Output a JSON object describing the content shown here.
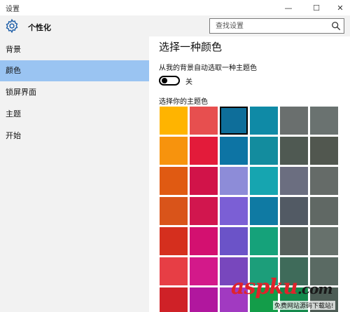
{
  "window": {
    "title": "设置",
    "controls": {
      "minimize": "—",
      "maximize": "☐",
      "close": "✕"
    }
  },
  "sidebar": {
    "header_title": "个性化",
    "header_icon": "gear-icon",
    "items": [
      {
        "label": "背景",
        "active": false
      },
      {
        "label": "颜色",
        "active": true
      },
      {
        "label": "锁屏界面",
        "active": false
      },
      {
        "label": "主题",
        "active": false
      },
      {
        "label": "开始",
        "active": false
      }
    ],
    "active_color": "#9ac4f2"
  },
  "search": {
    "placeholder": "查找设置",
    "icon": "search-icon"
  },
  "main": {
    "heading": "选择一种颜色",
    "auto_pick_label": "从我的背景自动选取一种主题色",
    "toggle_state_label": "关",
    "toggle_on": false,
    "accent_label": "选择你的主题色"
  },
  "swatches": [
    [
      "#ffb400",
      "#e74f4f",
      "#0e6e9a",
      "#0f8aa6",
      "#6a6f6e",
      "#6a7270"
    ],
    [
      "#f7930d",
      "#e31b3a",
      "#0d74a4",
      "#138c9e",
      "#4f5952",
      "#51574f"
    ],
    [
      "#e05a12",
      "#d11349",
      "#8d8cd8",
      "#16a5b0",
      "#6b6e80",
      "#656b68"
    ],
    [
      "#d9541a",
      "#d1164e",
      "#7b5fd5",
      "#0f7aa3",
      "#525a64",
      "#606864"
    ],
    [
      "#d52f1e",
      "#d31070",
      "#6b53c8",
      "#15a27a",
      "#56605c",
      "#67716c"
    ],
    [
      "#e73e45",
      "#d3198a",
      "#7847bd",
      "#1c9e7a",
      "#3f6b5a",
      "#5a6a63"
    ],
    [
      "#cf2127",
      "#b1179e",
      "#a13ac1",
      "#139d49",
      "#14894c",
      "#4c5c55"
    ]
  ],
  "selected_swatch": [
    0,
    2
  ],
  "watermark": {
    "brand": "aspku",
    "domain": ".com",
    "subtitle": "免费网站源码下载站!"
  }
}
